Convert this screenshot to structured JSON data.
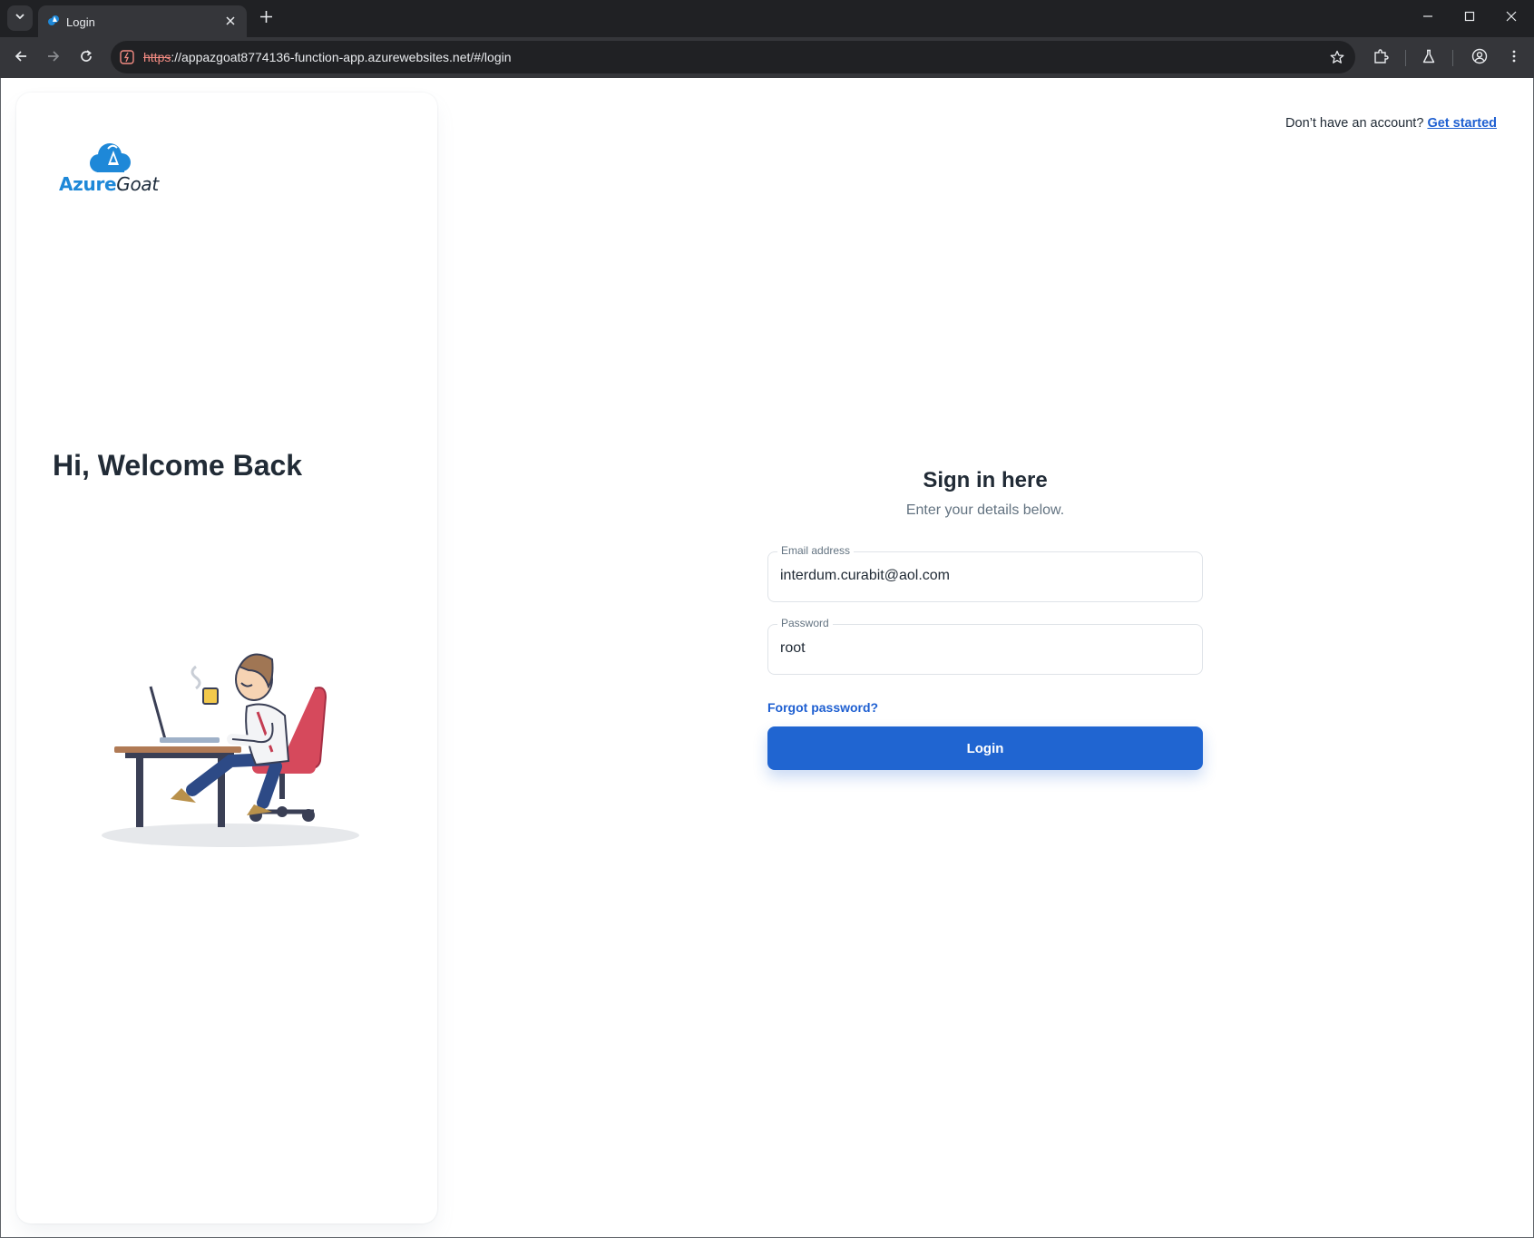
{
  "browser": {
    "tab_title": "Login",
    "url_scheme": "https",
    "url_rest": "://appazgoat8774136-function-app.azurewebsites.net/#/login"
  },
  "brand": {
    "logo_text_azure": "Azure",
    "logo_text_goat": "Goat",
    "accent": "#2065d1"
  },
  "side_panel": {
    "heading": "Hi, Welcome Back"
  },
  "header": {
    "prompt": "Don’t have an account?",
    "link": "Get started"
  },
  "form": {
    "title": "Sign in here",
    "subtitle": "Enter your details below.",
    "email_label": "Email address",
    "email_value": "interdum.curabit@aol.com",
    "password_label": "Password",
    "password_value": "root",
    "forgot_link": "Forgot password?",
    "submit_label": "Login"
  }
}
